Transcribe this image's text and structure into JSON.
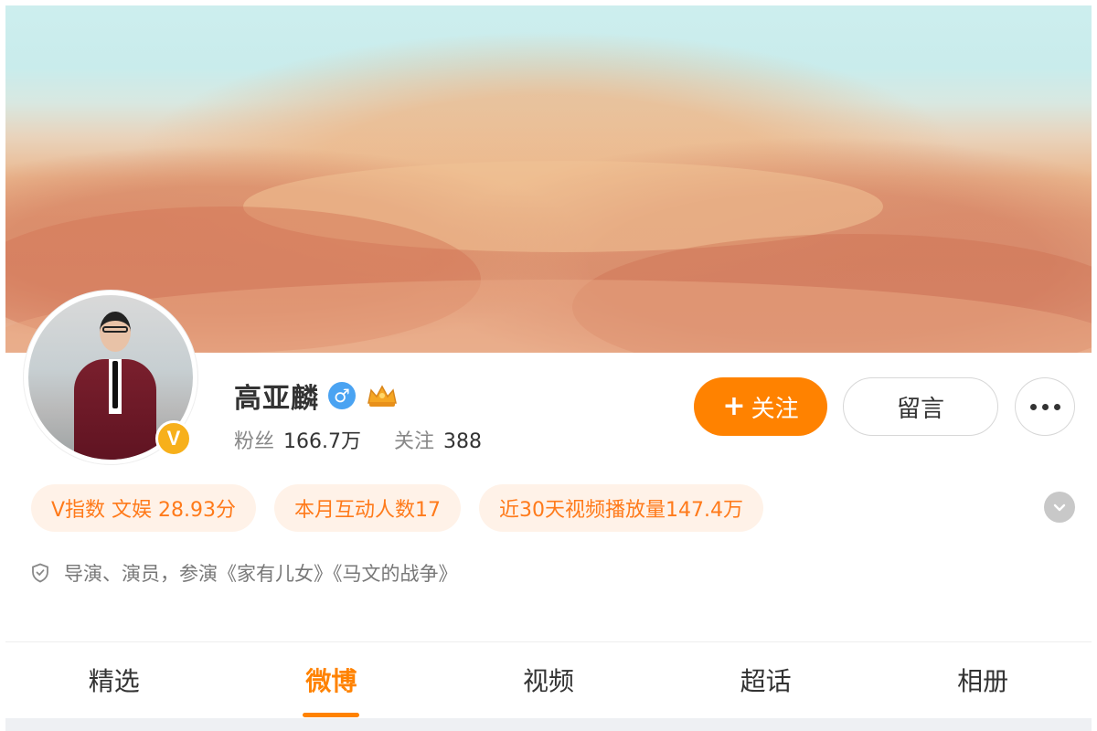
{
  "profile": {
    "name": "高亚麟",
    "gender_symbol": "♂",
    "verified_badge": "V",
    "fans_label": "粉丝",
    "fans_count": "166.7万",
    "following_label": "关注",
    "following_count": "388",
    "description": "导演、演员，参演《家有儿女》《马文的战争》"
  },
  "actions": {
    "follow_label": "关注",
    "follow_plus": "+",
    "message_label": "留言"
  },
  "tags": [
    {
      "text": "V指数 文娱 28.93分"
    },
    {
      "text": "本月互动人数17"
    },
    {
      "text": "近30天视频播放量147.4万"
    }
  ],
  "tabs": [
    {
      "label": "精选"
    },
    {
      "label": "微博"
    },
    {
      "label": "视频"
    },
    {
      "label": "超话"
    },
    {
      "label": "相册"
    }
  ],
  "active_tab": "微博",
  "colors": {
    "accent": "#ff8200",
    "tag_text": "#ff7a1a",
    "tag_bg": "#fff2e8",
    "gender": "#4aa3f2",
    "verified": "#f7b01b"
  },
  "icons": {
    "gender": "male-icon",
    "crown": "crown-icon",
    "verified": "verified-badge-icon",
    "expand": "chevron-down-icon",
    "shield": "shield-icon",
    "more": "more-dots-icon"
  }
}
